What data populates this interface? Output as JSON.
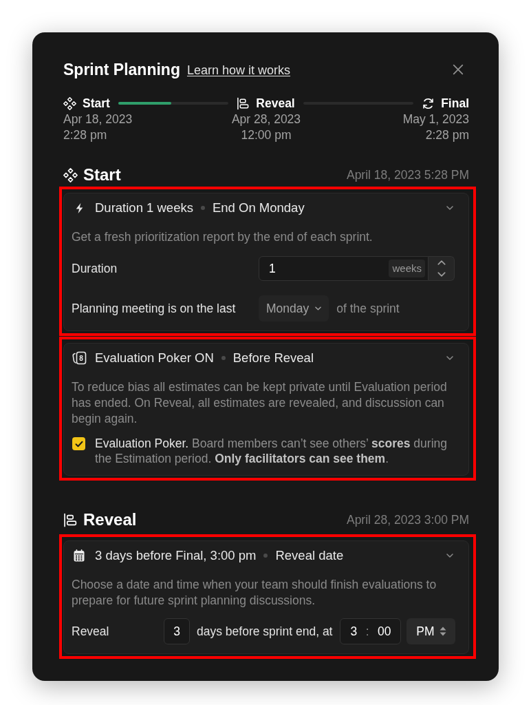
{
  "dialog": {
    "title": "Sprint Planning",
    "help_link": "Learn how it works"
  },
  "timeline": {
    "stages": [
      {
        "kind": "start",
        "label": "Start",
        "date": "Apr 18, 2023",
        "time": "2:28 pm"
      },
      {
        "kind": "reveal",
        "label": "Reveal",
        "date": "Apr 28, 2023",
        "time": "12:00 pm"
      },
      {
        "kind": "final",
        "label": "Final",
        "date": "May 1, 2023",
        "time": "2:28 pm"
      }
    ],
    "tracks": [
      {
        "level": 0.48
      },
      {
        "level": 0
      }
    ]
  },
  "sections": [
    {
      "kind": "start",
      "title": "Start",
      "timestamp": "April 18, 2023 5:28 PM",
      "cards": [
        {
          "kind": "duration",
          "highlighted": true,
          "expanded": true,
          "summary": "Duration 1 weeks",
          "detail": "End On Monday",
          "description": "Get a fresh prioritization report by the end of each sprint.",
          "rows": [
            {
              "kind": "number",
              "label": "Duration",
              "value": "1",
              "unit": "weeks"
            },
            {
              "kind": "select",
              "label": "Planning meeting is on the last",
              "value": "Monday",
              "suffix": "of the sprint"
            }
          ]
        },
        {
          "kind": "poker",
          "highlighted": true,
          "expanded": true,
          "icon_label": "8",
          "summary": "Evaluation Poker ON",
          "detail": "Before Reveal",
          "description": "To reduce bias all estimates can be kept private until Evaluation period has ended. On Reveal, all estimates are revealed, and discussion can begin again.",
          "rows": [
            {
              "kind": "checkbox",
              "checked": true,
              "lead": "Evaluation Poker.",
              "text": "Board members can’t see others’ **scores** during the Estimation period. **Only facilitators can see them**."
            }
          ]
        }
      ]
    },
    {
      "kind": "reveal",
      "title": "Reveal",
      "timestamp": "April 28, 2023 3:00 PM",
      "cards": [
        {
          "kind": "schedule",
          "highlighted": true,
          "expanded": true,
          "summary": "3 days before Final, 3:00 pm",
          "detail": "Reveal date",
          "description": "Choose a date and time when your team should finish evaluations to prepare for future sprint planning discussions.",
          "rows": [
            {
              "kind": "reveal_time",
              "label": "Reveal",
              "days": "3",
              "text": "days before sprint end, at",
              "hour": "3",
              "separator": ":",
              "minute": "00",
              "period": "PM"
            }
          ]
        }
      ]
    }
  ]
}
